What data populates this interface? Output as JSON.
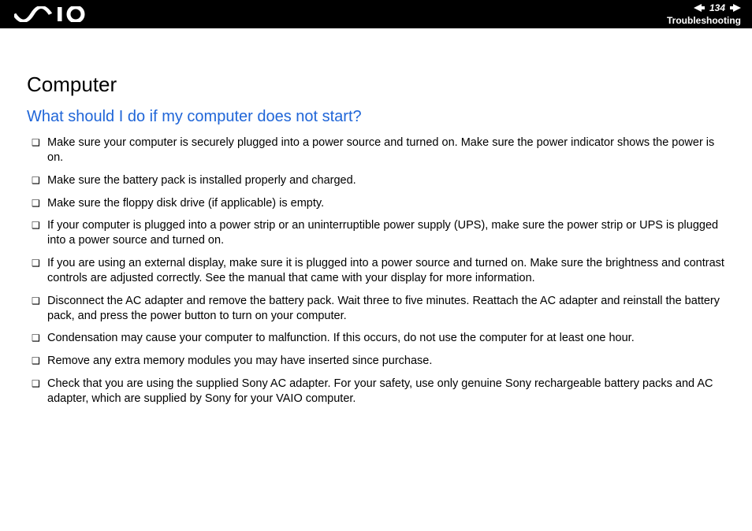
{
  "header": {
    "page_number": "134",
    "section": "Troubleshooting"
  },
  "content": {
    "title": "Computer",
    "question": "What should I do if my computer does not start?",
    "items": [
      "Make sure your computer is securely plugged into a power source and turned on. Make sure the power indicator shows the power is on.",
      "Make sure the battery pack is installed properly and charged.",
      "Make sure the floppy disk drive (if applicable) is empty.",
      "If your computer is plugged into a power strip or an uninterruptible power supply (UPS), make sure the power strip or UPS is plugged into a power source and turned on.",
      "If you are using an external display, make sure it is plugged into a power source and turned on. Make sure the brightness and contrast controls are adjusted correctly. See the manual that came with your display for more information.",
      "Disconnect the AC adapter and remove the battery pack. Wait three to five minutes. Reattach the AC adapter and reinstall the battery pack, and press the power button to turn on your computer.",
      "Condensation may cause your computer to malfunction. If this occurs, do not use the computer for at least one hour.",
      "Remove any extra memory modules you may have inserted since purchase.",
      "Check that you are using the supplied Sony AC adapter. For your safety, use only genuine Sony rechargeable battery packs and AC adapter, which are supplied by Sony for your VAIO computer."
    ]
  }
}
